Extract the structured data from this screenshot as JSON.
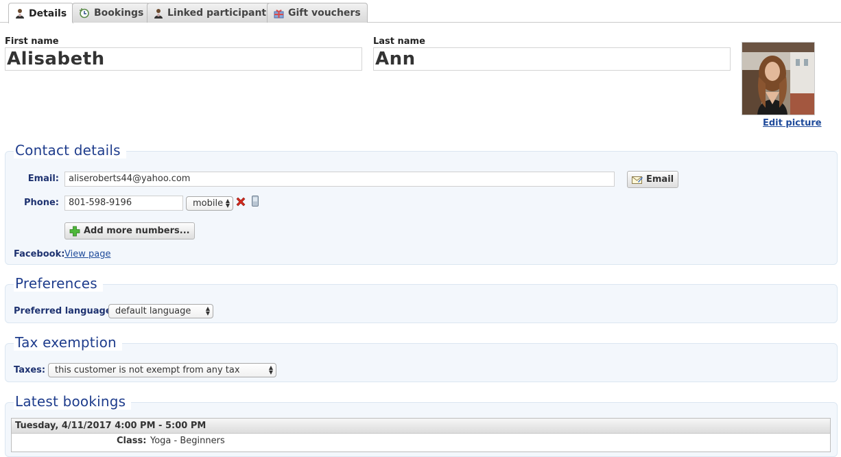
{
  "tabs": [
    {
      "label": "Details",
      "icon": "person-icon",
      "active": true
    },
    {
      "label": "Bookings",
      "icon": "calendar-refresh-icon",
      "active": false
    },
    {
      "label": "Linked participants",
      "icon": "person-icon",
      "active": false
    },
    {
      "label": "Gift vouchers",
      "icon": "gift-icon",
      "active": false
    }
  ],
  "name": {
    "first_label": "First name",
    "first_value": "Alisabeth",
    "last_label": "Last name",
    "last_value": "Ann"
  },
  "picture": {
    "edit_label": "Edit picture"
  },
  "contact": {
    "legend": "Contact details",
    "email_label": "Email:",
    "email_value": "aliseroberts44@yahoo.com",
    "email_button": "Email",
    "phone_label": "Phone:",
    "phone_value": "801-598-9196",
    "phone_type": "mobile",
    "add_numbers_button": "Add more numbers...",
    "facebook_label": "Facebook:",
    "facebook_link": "View page"
  },
  "preferences": {
    "legend": "Preferences",
    "language_label": "Preferred language:",
    "language_value": "default language"
  },
  "tax": {
    "legend": "Tax exemption",
    "taxes_label": "Taxes:",
    "taxes_value": "this customer is not exempt from any tax"
  },
  "bookings": {
    "legend": "Latest bookings",
    "entries": [
      {
        "datetime": "Tuesday, 4/11/2017 4:00 PM - 5:00 PM",
        "class_label": "Class:",
        "class_value": "Yoga - Beginners"
      }
    ]
  },
  "colors": {
    "legend_text": "#1e3c8c",
    "label_text": "#1e3270",
    "link": "#1e4a9a",
    "panel_bg": "#f3f7fc"
  }
}
